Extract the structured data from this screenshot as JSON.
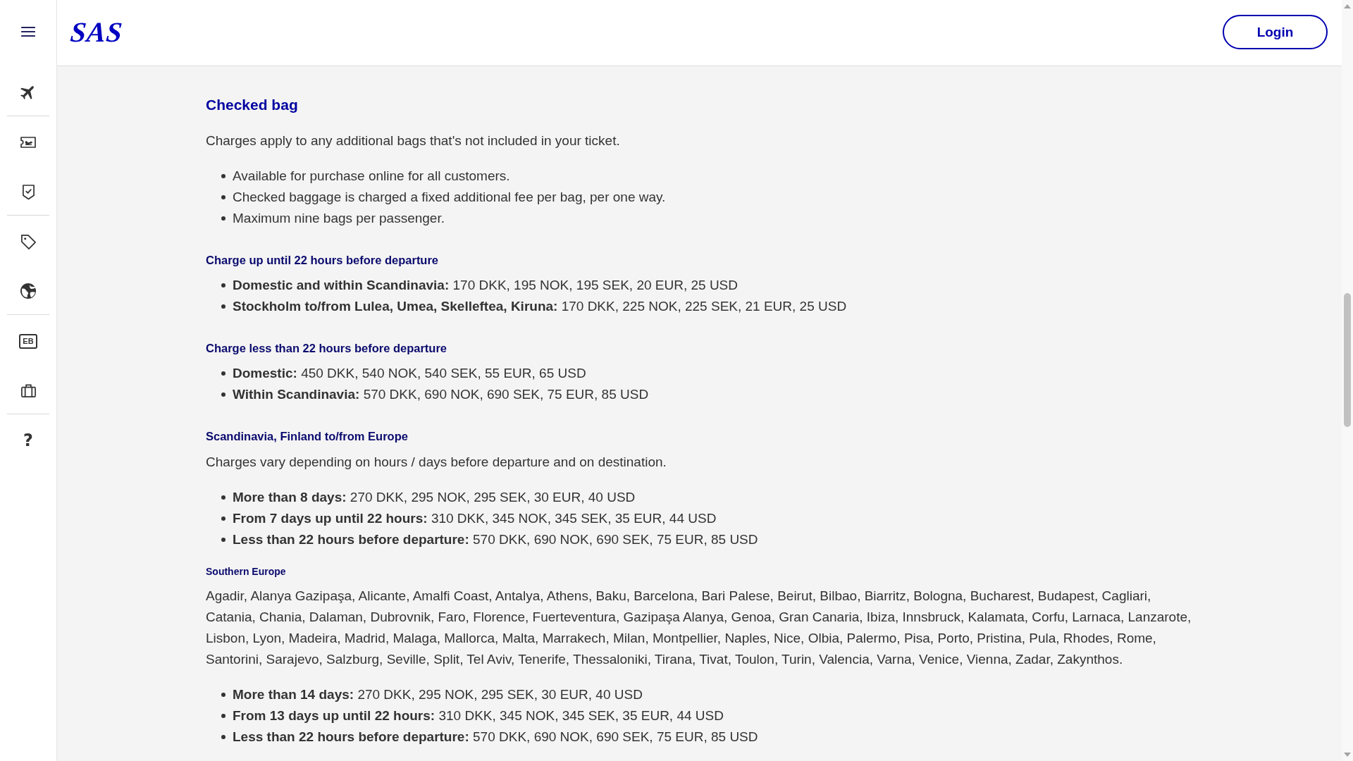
{
  "header": {
    "logo": "SAS",
    "login_button": "Login"
  },
  "sidebar": {
    "card_label": "EB",
    "help_label": "?"
  },
  "content": {
    "title": "Checked bag",
    "intro": "Charges apply to any additional bags that's not included in your ticket.",
    "bullets": [
      "Available for purchase online for all customers.",
      "Checked baggage is charged a fixed additional fee per bag, per one way.",
      "Maximum nine bags per passenger."
    ],
    "sections": [
      {
        "heading": "Charge up until 22 hours before departure",
        "bullets": [
          "**Domestic and within Scandinavia:** 170 DKK, 195 NOK, 195 SEK, 20 EUR, 25 USD",
          "**Stockholm to/from Lulea, Umea, Skelleftea, Kiruna:** 170 DKK, 225 NOK, 225 SEK, 21 EUR, 25 USD"
        ]
      },
      {
        "heading": "Charge less than 22 hours before departure",
        "bullets": [
          "**Domestic:** 450 DKK, 540 NOK, 540 SEK, 55 EUR, 65 USD",
          "**Within Scandinavia:** 570 DKK, 690 NOK, 690 SEK, 75 EUR, 85 USD"
        ]
      },
      {
        "heading": "Scandinavia, Finland to/from Europe",
        "text": "Charges vary depending on hours / days before departure and on destination.",
        "bullets": [
          "**More than 8 days:** 270 DKK, 295 NOK, 295 SEK, 30 EUR, 40 USD",
          "**From 7 days up until 22 hours:** 310 DKK, 345 NOK, 345 SEK, 35 EUR, 44 USD",
          "**Less than 22 hours before departure:** 570 DKK, 690 NOK, 690 SEK, 75 EUR, 85 USD"
        ],
        "children": [
          {
            "heading": "Southern Europe",
            "text": "Agadir, Alanya Gazipaşa, Alicante, Amalfi Coast, Antalya, Athens, Baku, Barcelona, Bari Palese, Beirut, Bilbao, Biarritz, Bologna, Bucharest, Budapest, Cagliari, Catania, Chania, Dalaman, Dubrovnik, Faro, Florence, Fuerteventura, Gazipaşa Alanya, Genoa, Gran Canaria, Ibiza, Innsbruck, Kalamata, Corfu, Larnaca, Lanzarote, Lisbon, Lyon, Madeira, Madrid, Malaga, Mallorca, Malta, Marrakech, Milan, Montpellier, Naples, Nice, Olbia, Palermo, Pisa, Porto, Pristina, Pula, Rhodes, Rome, Santorini, Sarajevo, Salzburg, Seville, Split, Tel Aviv, Tenerife, Thessaloniki, Tirana, Tivat, Toulon, Turin, Valencia, Varna, Venice, Vienna, Zadar, Zakynthos.",
            "bullets": [
              "**More than 14 days:** 270 DKK, 295 NOK, 295 SEK, 30 EUR, 40 USD",
              "**From 13 days up until 22 hours:** 310 DKK, 345 NOK, 345 SEK, 35 EUR, 44 USD",
              "**Less than 22 hours before departure:** 570 DKK, 690 NOK, 690 SEK, 75 EUR, 85 USD"
            ]
          }
        ]
      }
    ]
  }
}
